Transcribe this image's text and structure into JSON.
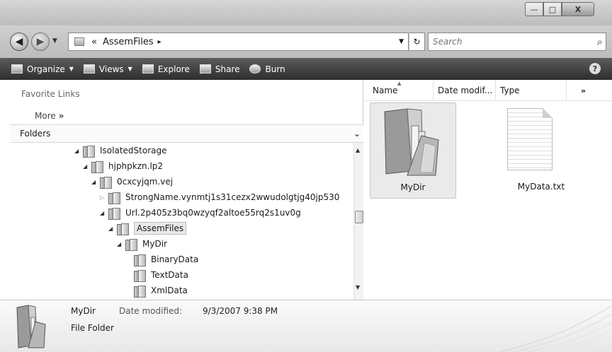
{
  "window": {
    "title": "",
    "controls": {
      "minimize": "—",
      "maximize": "□",
      "close": "X"
    }
  },
  "address_bar": {
    "chevrons": "«",
    "crumb": "AssemFiles",
    "crumb_arrow": "▸",
    "refresh_glyph": "↻",
    "search_placeholder": "Search"
  },
  "toolbar": {
    "items": [
      {
        "label": "Organize",
        "icon": "organize-icon",
        "dropdown": true
      },
      {
        "label": "Views",
        "icon": "views-icon",
        "dropdown": true
      },
      {
        "label": "Explore",
        "icon": "explore-icon",
        "dropdown": false
      },
      {
        "label": "Share",
        "icon": "share-icon",
        "dropdown": false
      },
      {
        "label": "Burn",
        "icon": "burn-icon",
        "dropdown": false
      }
    ],
    "help": "?"
  },
  "nav_pane": {
    "favorite_links_title": "Favorite Links",
    "more_label": "More",
    "more_glyph": "»",
    "folders_label": "Folders",
    "folders_chevron": "⌄",
    "tree": [
      {
        "label": "IsolatedStorage",
        "depth": 0,
        "expanded": true
      },
      {
        "label": "hjphpkzn.lp2",
        "depth": 1,
        "expanded": true
      },
      {
        "label": "0cxcyjqm.vej",
        "depth": 2,
        "expanded": true
      },
      {
        "label": "StrongName.vynmtj1s31cezx2wwudolgtjg40jp530",
        "depth": 3,
        "expanded": false
      },
      {
        "label": "Url.2p405z3bq0wzyqf2altoe55rq2s1uv0g",
        "depth": 3,
        "expanded": true
      },
      {
        "label": "AssemFiles",
        "depth": 4,
        "expanded": true,
        "selected": true
      },
      {
        "label": "MyDir",
        "depth": 5,
        "expanded": true
      },
      {
        "label": "BinaryData",
        "depth": 6,
        "leaf": true
      },
      {
        "label": "TextData",
        "depth": 6,
        "leaf": true
      },
      {
        "label": "XmlData",
        "depth": 6,
        "leaf": true
      }
    ]
  },
  "file_list": {
    "columns": [
      "Name",
      "Date modif...",
      "Type",
      "»"
    ],
    "sorted_column": "Name",
    "items": [
      {
        "name": "MyDir",
        "kind": "folder",
        "selected": true
      },
      {
        "name": "MyData.txt",
        "kind": "text-file",
        "selected": false
      }
    ]
  },
  "details": {
    "name": "MyDir",
    "date_label": "Date modified:",
    "date_value": "9/3/2007 9:38 PM",
    "type": "File Folder"
  }
}
